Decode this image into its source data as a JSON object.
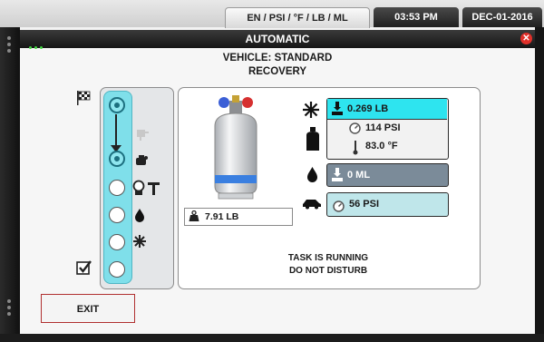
{
  "status_bar": {
    "units": "EN / PSI / °F / LB / ML",
    "time": "03:53 PM",
    "date": "DEC-01-2016"
  },
  "window": {
    "title": "AUTOMATIC"
  },
  "header": {
    "vehicle": "VEHICLE: STANDARD",
    "mode": "RECOVERY"
  },
  "tank": {
    "weight": "7.91 LB"
  },
  "refrigerant": {
    "amount": "0.269 LB",
    "pressure": "114 PSI",
    "temperature": "83.0 °F"
  },
  "oil": {
    "amount": "0 ML"
  },
  "vehicle_pressure": {
    "value": "56 PSI"
  },
  "task": {
    "line1": "TASK IS RUNNING",
    "line2": "DO NOT DISTURB"
  },
  "buttons": {
    "exit": "EXIT"
  },
  "icons": {
    "flag": "checkered-flag-icon",
    "check": "checkbox-checked-icon",
    "snowflake": "snowflake-icon",
    "drop": "oil-drop-icon",
    "car": "car-icon",
    "tank": "refrigerant-tank-icon"
  },
  "colors": {
    "refrigerant_highlight": "#2ee4ef",
    "oil_box": "#7b8b99",
    "vehicle_box": "#bfe6ea",
    "track": "#7fdfea",
    "exit_border": "#b03030",
    "close": "#e0302a"
  }
}
